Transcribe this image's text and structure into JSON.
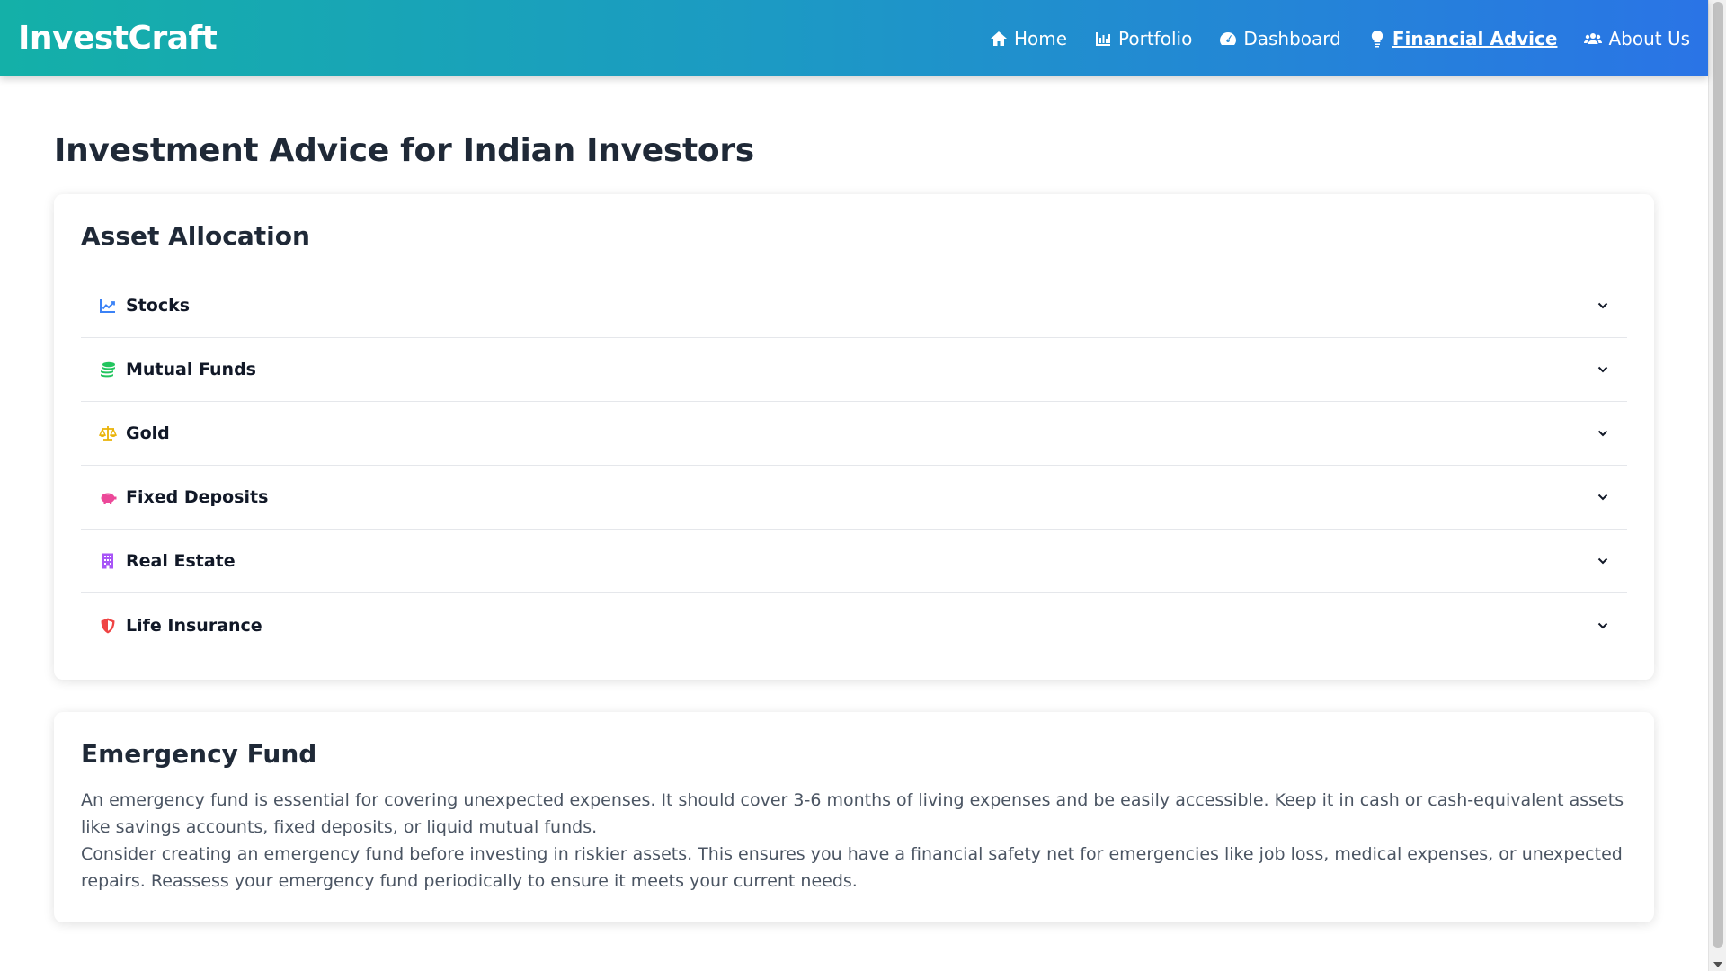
{
  "header": {
    "brand": "InvestCraft",
    "nav": [
      {
        "label": "Home",
        "icon": "home-icon"
      },
      {
        "label": "Portfolio",
        "icon": "chart-bar-icon"
      },
      {
        "label": "Dashboard",
        "icon": "gauge-icon"
      },
      {
        "label": "Financial Advice",
        "icon": "lightbulb-icon",
        "active": true
      },
      {
        "label": "About Us",
        "icon": "users-icon"
      }
    ]
  },
  "main": {
    "title": "Investment Advice for Indian Investors",
    "asset_allocation": {
      "title": "Asset Allocation",
      "items": [
        {
          "label": "Stocks",
          "icon": "chart-line-icon",
          "color": "#3b82f6"
        },
        {
          "label": "Mutual Funds",
          "icon": "coins-icon",
          "color": "#22c55e"
        },
        {
          "label": "Gold",
          "icon": "balance-scale-icon",
          "color": "#eab308"
        },
        {
          "label": "Fixed Deposits",
          "icon": "piggy-bank-icon",
          "color": "#ec4899"
        },
        {
          "label": "Real Estate",
          "icon": "building-icon",
          "color": "#a855f7"
        },
        {
          "label": "Life Insurance",
          "icon": "shield-icon",
          "color": "#ef4444"
        }
      ]
    },
    "emergency_fund": {
      "title": "Emergency Fund",
      "paragraph1": "An emergency fund is essential for covering unexpected expenses. It should cover 3-6 months of living expenses and be easily accessible. Keep it in cash or cash-equivalent assets like savings accounts, fixed deposits, or liquid mutual funds.",
      "paragraph2": "Consider creating an emergency fund before investing in riskier assets. This ensures you have a financial safety net for emergencies like job loss, medical expenses, or unexpected repairs. Reassess your emergency fund periodically to ensure it meets your current needs."
    }
  }
}
